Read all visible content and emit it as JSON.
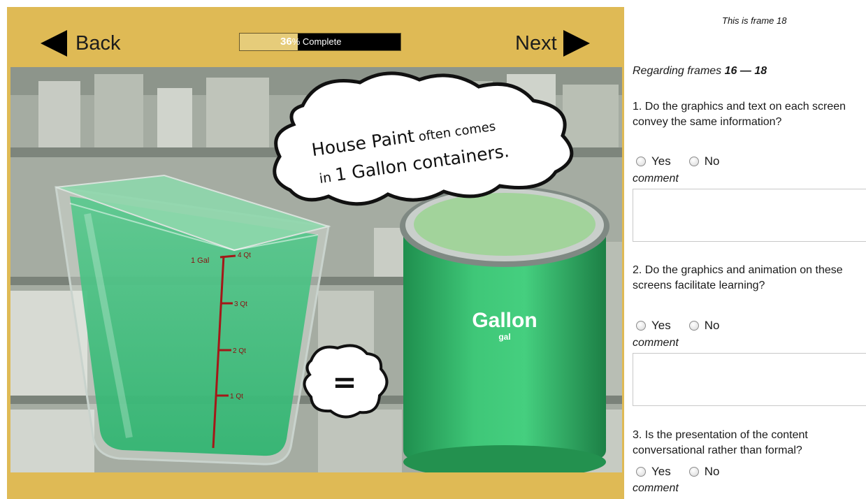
{
  "lesson": {
    "back_label": "Back",
    "next_label": "Next",
    "progress": {
      "percent_value": 36,
      "percent_text": "36",
      "suffix": "% Complete"
    },
    "speech_bubble": {
      "part1": "House Paint",
      "part2": " often comes",
      "part3": "in ",
      "part4": "1 Gallon containers."
    },
    "equals_symbol": "=",
    "bucket_marks": [
      "1 Gal",
      "4 Qt",
      "3 Qt",
      "2 Qt",
      "1 Qt"
    ],
    "can_label": "Gallon",
    "can_sublabel": "gal",
    "colors": {
      "frame_gold": "#dfba55",
      "paint_green": "#34b96a"
    }
  },
  "questions_panel": {
    "frame_label": "This is frame 18",
    "regarding_prefix": "Regarding frames ",
    "regarding_from": "16",
    "regarding_dash": " — ",
    "regarding_to": "18",
    "questions": [
      {
        "text": "1. Do the graphics and text on each screen convey the same information?",
        "yes": "Yes",
        "no": "No",
        "comment": "comment"
      },
      {
        "text": "2. Do the graphics and animation on these screens facilitate learning?",
        "yes": "Yes",
        "no": "No",
        "comment": "comment"
      },
      {
        "text": "3. Is the presentation of the content conversational rather than formal?",
        "yes": "Yes",
        "no": "No",
        "comment": "comment"
      }
    ]
  }
}
